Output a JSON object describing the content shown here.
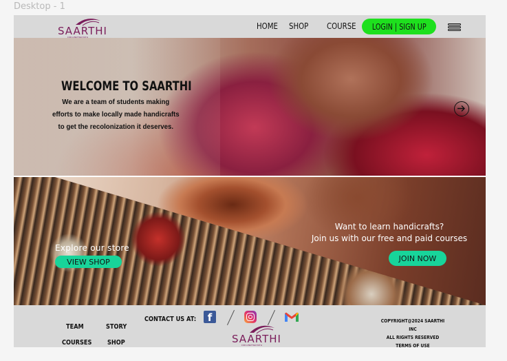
{
  "frame": {
    "label": "Desktop - 1"
  },
  "brand": {
    "name": "SAARTHI",
    "tagline": "FOR A BETTER PATH",
    "color": "#7a1d5a"
  },
  "nav": {
    "items": [
      "HOME",
      "SHOP",
      "COURSE"
    ],
    "login_label": "LOGIN | SIGN UP",
    "login_color": "#1ee01e",
    "menu_icon": "hamburger-menu-icon"
  },
  "hero": {
    "title": "WELCOME TO SAARTHI",
    "text": "We are a team of students making efforts to make locally made handicrafts to get the recolonization it deserves.",
    "next_icon": "arrow-right-circle-icon"
  },
  "banner": {
    "explore_text": "Explore our store",
    "view_shop_label": "VIEW SHOP",
    "learn_line1": "Want to learn handicrafts?",
    "learn_line2": "Join us with our free and paid courses",
    "join_label": "JOIN NOW",
    "button_color": "#18d49a"
  },
  "footer": {
    "links": [
      "TEAM",
      "STORY",
      "COURSES",
      "SHOP"
    ],
    "contact_label": "CONTACT US AT:",
    "social_icons": [
      "facebook-icon",
      "instagram-icon",
      "gmail-icon"
    ],
    "copyright": "COPYRIGHT@2024 SAARTHI INC",
    "rights": "ALL RIGHTS RESERVED",
    "terms": "TERMS OF USE"
  }
}
